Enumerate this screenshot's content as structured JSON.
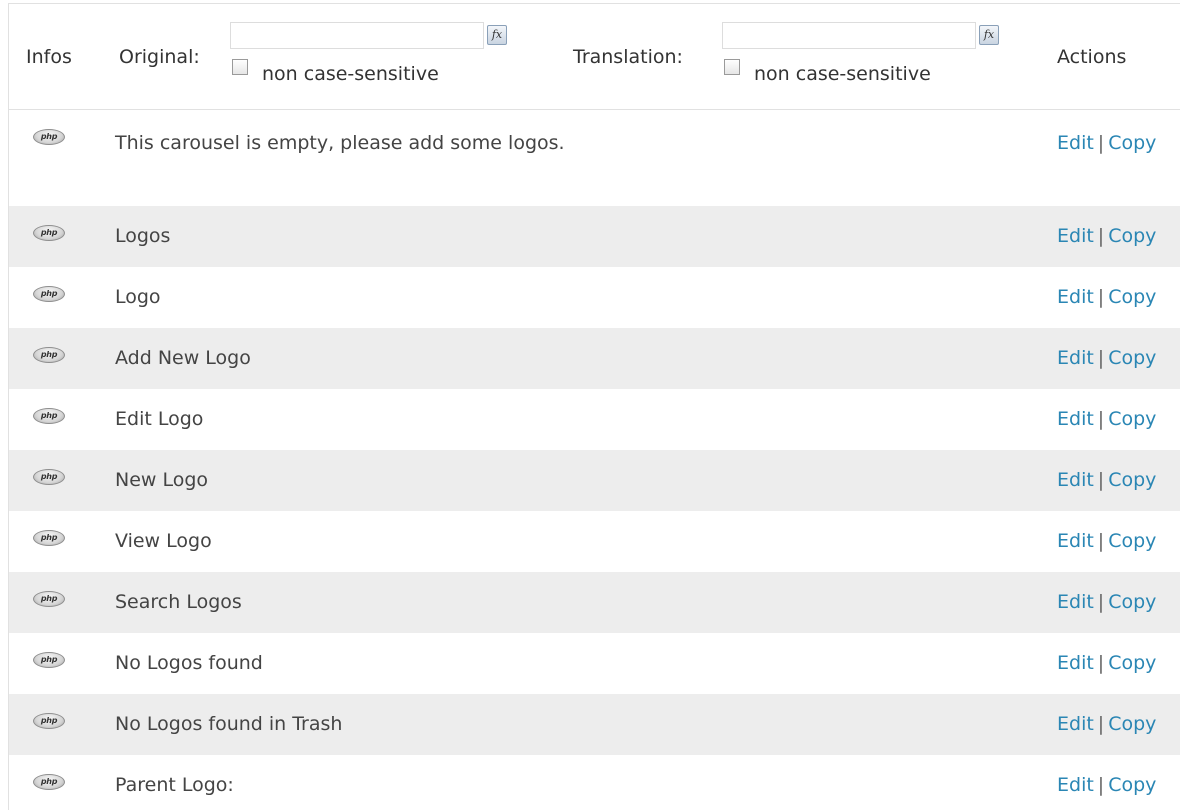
{
  "header": {
    "infos": "Infos",
    "original": "Original:",
    "translation": "Translation:",
    "actions": "Actions",
    "fx_symbol": "fx",
    "case_label": "non case-sensitive",
    "original_filter_value": "",
    "translation_filter_value": ""
  },
  "icon_label": "php",
  "row_actions": {
    "edit": "Edit",
    "copy": "Copy",
    "separator": "|"
  },
  "rows": [
    {
      "original": "This carousel is empty, please add some logos."
    },
    {
      "original": "Logos"
    },
    {
      "original": "Logo"
    },
    {
      "original": "Add New Logo"
    },
    {
      "original": "Edit Logo"
    },
    {
      "original": "New Logo"
    },
    {
      "original": "View Logo"
    },
    {
      "original": "Search Logos"
    },
    {
      "original": "No Logos found"
    },
    {
      "original": "No Logos found in Trash"
    },
    {
      "original": "Parent Logo:"
    }
  ],
  "colors": {
    "link": "#2a86b4",
    "row_alt": "#ededed",
    "border": "#e1e1e1"
  }
}
